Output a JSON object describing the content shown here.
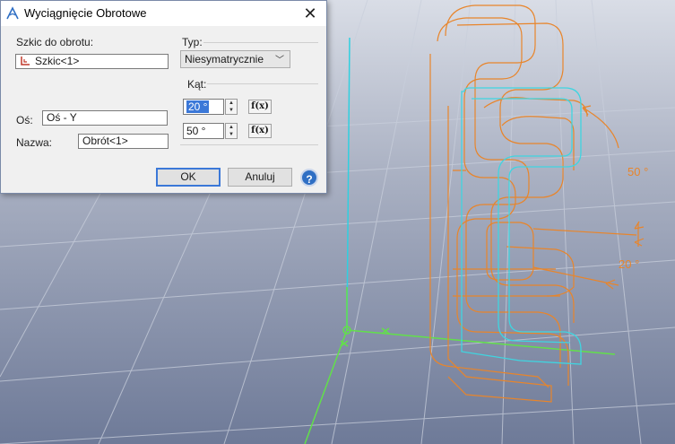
{
  "dialog": {
    "title": "Wyciągnięcie Obrotowe",
    "sketch_label": "Szkic do obrotu:",
    "sketch_value": "Szkic<1>",
    "axis_label": "Oś:",
    "axis_value": "Oś - Y",
    "name_label": "Nazwa:",
    "name_value": "Obrót<1>",
    "type_label": "Typ:",
    "type_value": "Niesymatrycznie",
    "angle_label": "Kąt:",
    "angle1_value": "20 °",
    "angle2_value": "50 °",
    "fx_label": "f(x)",
    "ok_label": "OK",
    "cancel_label": "Anuluj",
    "help_label": "?"
  },
  "viewport": {
    "angle_annotation_1": "50 °",
    "angle_annotation_2": "20 °"
  },
  "colors": {
    "profile": "#e8852b",
    "sketch": "#3fd5e0",
    "axis_y": "#2fd0e0",
    "axis_x": "#62e04a"
  }
}
